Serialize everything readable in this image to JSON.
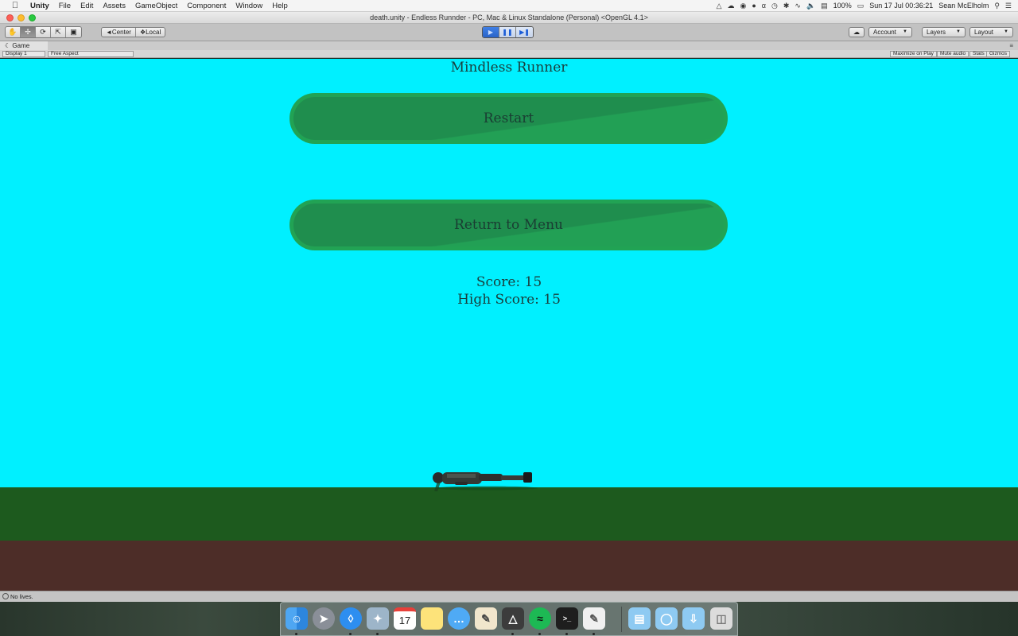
{
  "menubar": {
    "app_name": "Unity",
    "items": [
      "File",
      "Edit",
      "Assets",
      "GameObject",
      "Component",
      "Window",
      "Help"
    ],
    "battery": "100%",
    "datetime": "Sun 17 Jul  00:36:21",
    "user": "Sean McElholm"
  },
  "window": {
    "title": "death.unity - Endless Runnder - PC, Mac & Linux Standalone (Personal) <OpenGL 4.1>"
  },
  "toolbar": {
    "pivot_center": "Center",
    "pivot_local": "Local",
    "account": "Account",
    "layers": "Layers",
    "layout": "Layout"
  },
  "game_tab": {
    "label": "Game",
    "display": "Display 1",
    "aspect": "Free Aspect",
    "maximize": "Maximize on Play",
    "mute": "Mute audio",
    "stats": "Stats",
    "gizmos": "Gizmos"
  },
  "game": {
    "title": "Mindless Runner",
    "restart_label": "Restart",
    "menu_label": "Return to Menu",
    "score_text": "Score: 15",
    "high_score_text": "High Score: 15",
    "colors": {
      "sky": "#00f0ff",
      "button": "#21a354",
      "grass": "#1d5a1e",
      "dirt": "#4d2d28"
    }
  },
  "status": {
    "message": "No lives."
  },
  "dock": {
    "calendar_day": "17",
    "apps": [
      "finder-icon",
      "launchpad-icon",
      "safari-icon",
      "preview-icon",
      "calendar-icon",
      "notes-icon",
      "messages-icon",
      "textedit-icon",
      "unity-icon",
      "spotify-icon",
      "terminal-icon",
      "pages-icon",
      "folder-icon",
      "downloads-folder-icon",
      "airdrop-folder-icon",
      "trash-icon"
    ]
  }
}
